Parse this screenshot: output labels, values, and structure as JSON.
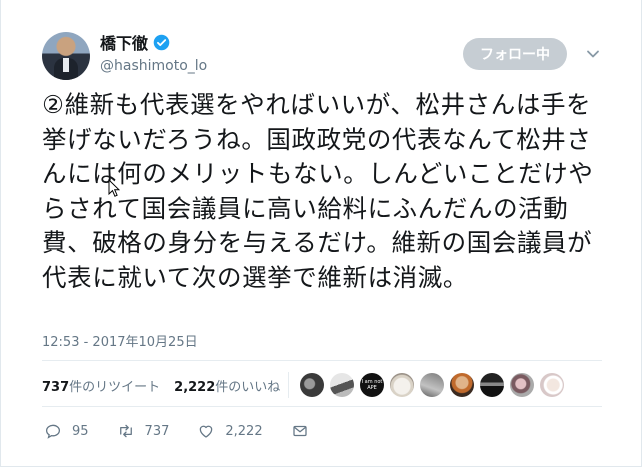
{
  "user": {
    "display_name": "橋下徹",
    "handle": "@hashimoto_lo"
  },
  "follow_button": {
    "label": "フォロー中"
  },
  "tweet": {
    "text": "②維新も代表選をやればいいが、松井さんは手を挙げないだろうね。国政政党の代表なんて松井さんには何のメリットもない。しんどいことだけやらされて国会議員に高い給料にふんだんの活動費、破格の身分を与えるだけ。維新の国会議員が代表に就いて次の選挙で維新は消滅。",
    "timestamp": "12:53 - 2017年10月25日"
  },
  "stats": {
    "retweets_count": "737",
    "retweets_label": "件のリツイート",
    "likes_count": "2,222",
    "likes_label": "件のいいね"
  },
  "liked_by": [
    {
      "icon": "avatar-dark-photo"
    },
    {
      "icon": "avatar-bw-photo"
    },
    {
      "icon": "avatar-text",
      "text": "I am not APE"
    },
    {
      "icon": "avatar-dog"
    },
    {
      "icon": "avatar-gray-photo"
    },
    {
      "icon": "avatar-orange-photo"
    },
    {
      "icon": "avatar-car"
    },
    {
      "icon": "avatar-pink-photo"
    },
    {
      "icon": "avatar-sketch"
    }
  ],
  "actions": {
    "reply_count": "95",
    "retweet_count": "737",
    "like_count": "2,222"
  },
  "colors": {
    "verified_blue": "#1da1f2",
    "secondary_text": "#657786",
    "follow_bg": "#c6cdd3"
  }
}
